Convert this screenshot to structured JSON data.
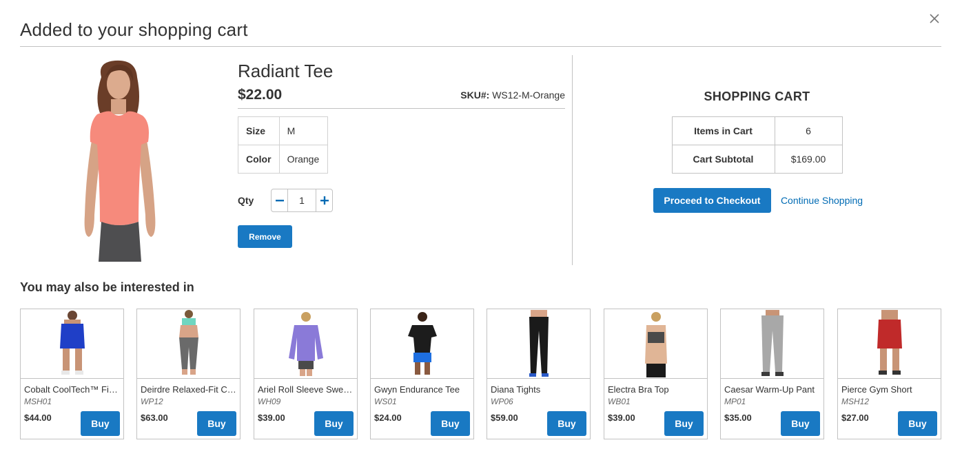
{
  "modal": {
    "title": "Added to your shopping cart",
    "close_icon": "close-icon"
  },
  "product": {
    "name": "Radiant Tee",
    "price": "$22.00",
    "sku_label": "SKU#:",
    "sku_value": "WS12-M-Orange",
    "options": [
      {
        "label": "Size",
        "value": "M"
      },
      {
        "label": "Color",
        "value": "Orange"
      }
    ],
    "qty_label": "Qty",
    "qty_value": "1",
    "remove_label": "Remove",
    "shirt_color": "#f68a7c"
  },
  "cart": {
    "title": "SHOPPING CART",
    "rows": [
      {
        "label": "Items in Cart",
        "value": "6"
      },
      {
        "label": "Cart Subtotal",
        "value": "$169.00"
      }
    ],
    "checkout_label": "Proceed to Checkout",
    "continue_label": "Continue Shopping"
  },
  "related": {
    "title": "You may also be interested in",
    "buy_label": "Buy",
    "items": [
      {
        "name": "Cobalt CoolTech™ Fit…",
        "sku": "MSH01",
        "price": "$44.00",
        "color": "#1f3fc7"
      },
      {
        "name": "Deirdre Relaxed-Fit C…",
        "sku": "WP12",
        "price": "$63.00",
        "color": "#6a6a6a"
      },
      {
        "name": "Ariel Roll Sleeve Swe…",
        "sku": "WH09",
        "price": "$39.00",
        "color": "#8a7ad8"
      },
      {
        "name": "Gwyn Endurance Tee",
        "sku": "WS01",
        "price": "$24.00",
        "color": "#1c1c1c"
      },
      {
        "name": "Diana Tights",
        "sku": "WP06",
        "price": "$59.00",
        "color": "#1a1a1a"
      },
      {
        "name": "Electra Bra Top",
        "sku": "WB01",
        "price": "$39.00",
        "color": "#4a4a4a"
      },
      {
        "name": "Caesar Warm-Up Pant",
        "sku": "MP01",
        "price": "$35.00",
        "color": "#a8a8a8"
      },
      {
        "name": "Pierce Gym Short",
        "sku": "MSH12",
        "price": "$27.00",
        "color": "#c02a2a"
      }
    ]
  },
  "colors": {
    "accent": "#1979c3",
    "link": "#006bb4",
    "border": "#c2c2c2"
  }
}
